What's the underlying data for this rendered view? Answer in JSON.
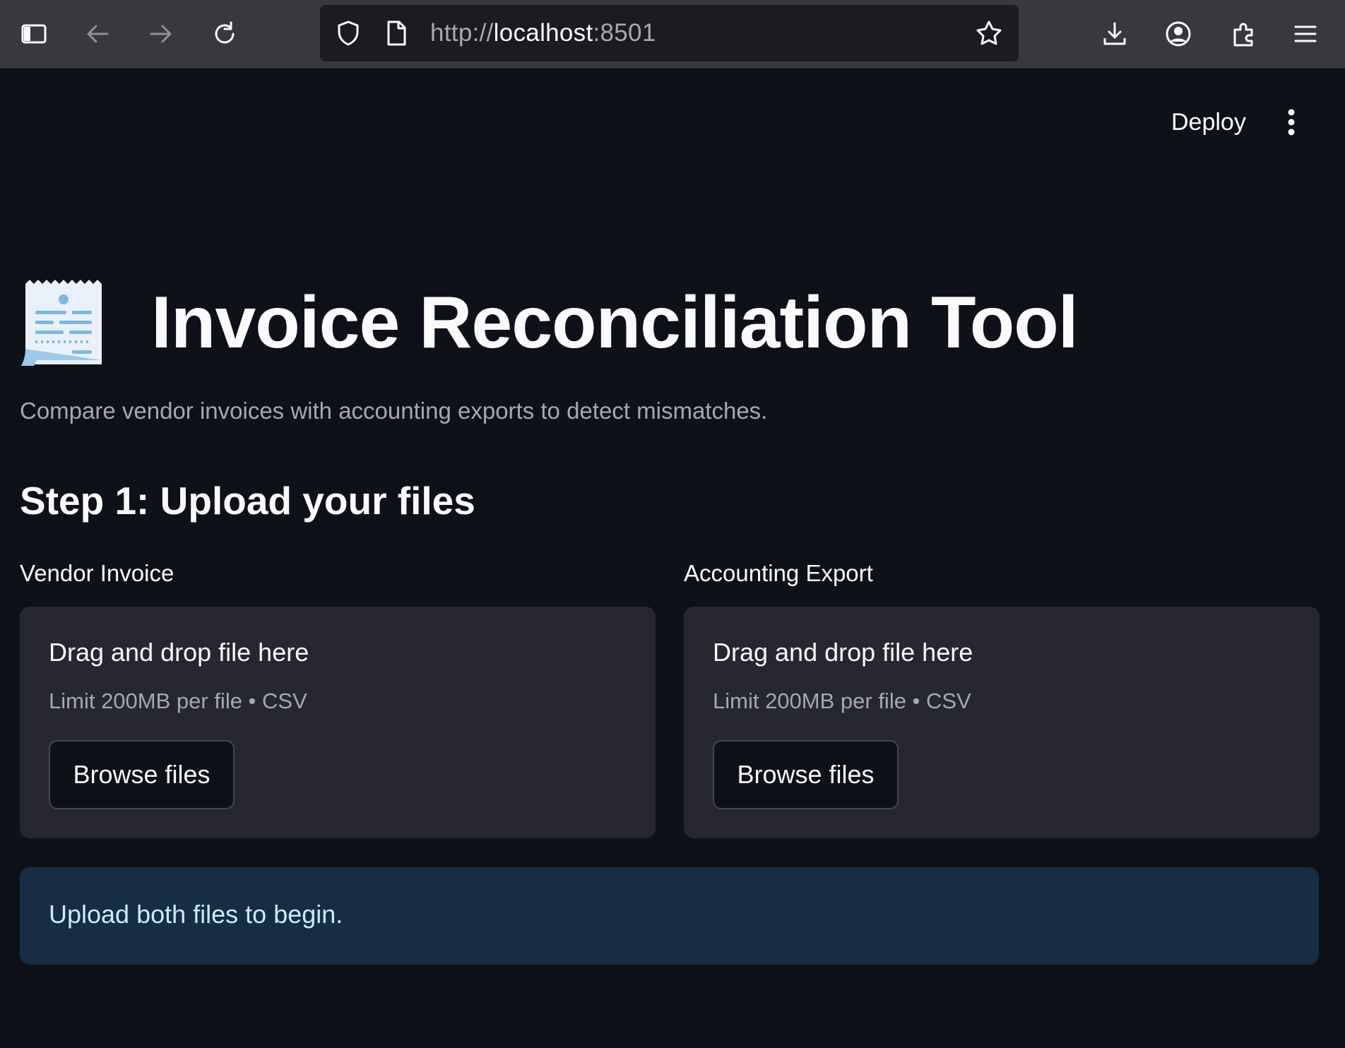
{
  "browser": {
    "url_scheme": "http://",
    "url_host": "localhost",
    "url_port": ":8501",
    "icons": [
      "sidebar-icon",
      "back-icon",
      "forward-icon",
      "reload-icon",
      "shield-icon",
      "page-icon",
      "star-icon",
      "download-icon",
      "account-icon",
      "extensions-icon",
      "menu-icon"
    ]
  },
  "toolbar": {
    "deploy_label": "Deploy",
    "menu_icon": "kebab-icon"
  },
  "header": {
    "emoji": "receipt-icon",
    "title": "Invoice Reconciliation Tool",
    "subtitle": "Compare vendor invoices with accounting exports to detect mismatches."
  },
  "step1": {
    "heading": "Step 1: Upload your files",
    "uploaders": [
      {
        "label": "Vendor Invoice",
        "drop_text": "Drag and drop file here",
        "limit_text": "Limit 200MB per file • CSV",
        "button_label": "Browse files"
      },
      {
        "label": "Accounting Export",
        "drop_text": "Drag and drop file here",
        "limit_text": "Limit 200MB per file • CSV",
        "button_label": "Browse files"
      }
    ]
  },
  "info": {
    "message": "Upload both files to begin."
  },
  "colors": {
    "app_bg": "#0e1117",
    "dropzone_bg": "#262730",
    "info_bg": "#172d43",
    "info_text": "#c7ebff"
  }
}
